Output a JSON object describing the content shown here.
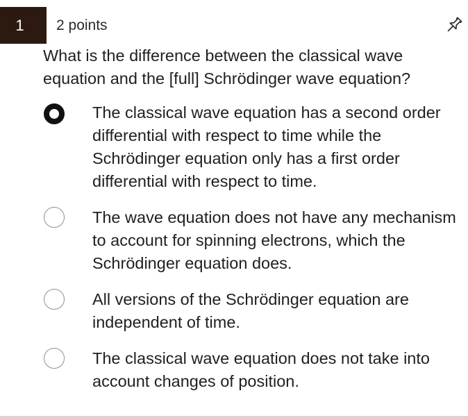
{
  "question": {
    "number": "1",
    "points": "2 points",
    "text": "What is the difference between the classical wave equation and the [full] Schrödinger wave equation?"
  },
  "icons": {
    "pin": "pin-icon"
  },
  "options": [
    {
      "label": "The classical wave equation has a second order differential with respect to time while the Schrödinger equation only has a first order differential with respect to time.",
      "selected": true
    },
    {
      "label": "The wave equation does not have any mechanism to account for spinning electrons, which the Schrödinger equation does.",
      "selected": false
    },
    {
      "label": "All versions of the Schrödinger equation are independent of time.",
      "selected": false
    },
    {
      "label": "The classical wave equation does not take into account changes of position.",
      "selected": false
    }
  ],
  "colors": {
    "number_badge_bg": "#2c1a10",
    "text": "#1f1f1f",
    "radio_border": "#8f8f8f",
    "radio_selected": "#111111"
  }
}
